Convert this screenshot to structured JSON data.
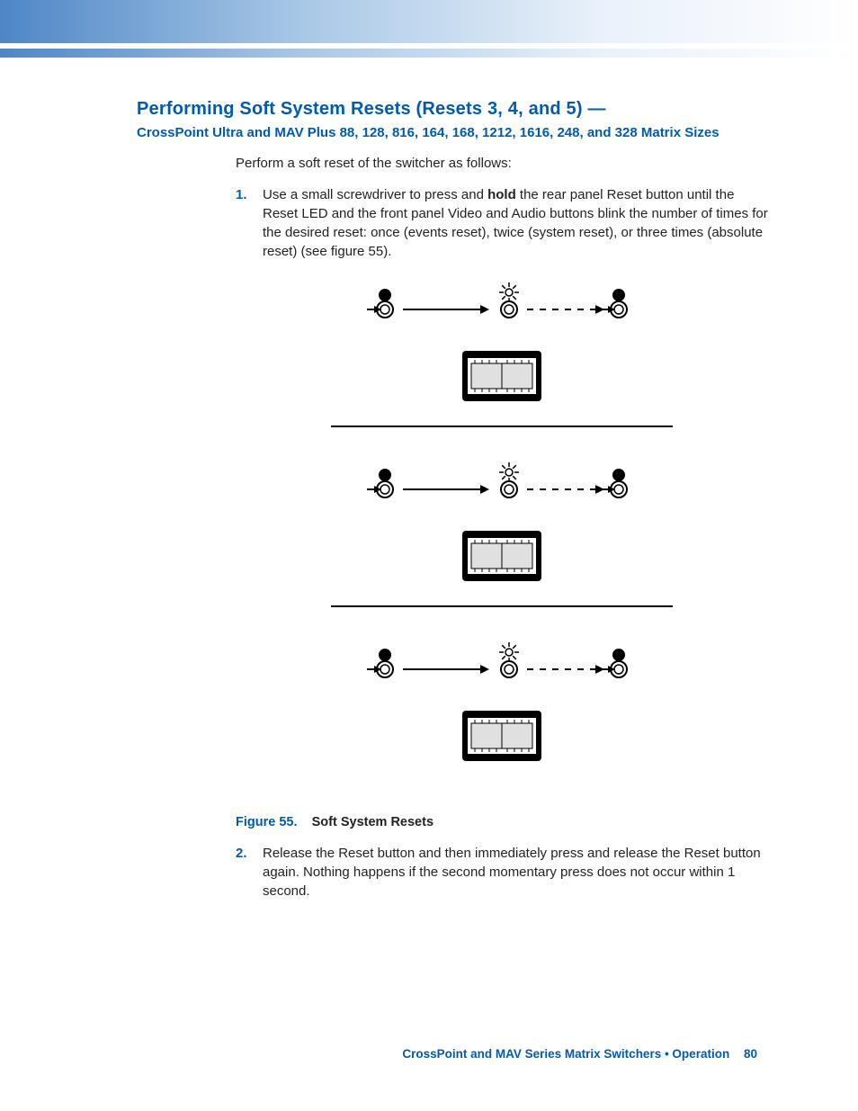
{
  "heading": {
    "title": "Performing Soft System Resets (Resets 3, 4, and 5) —",
    "subtitle": "CrossPoint Ultra and MAV Plus 88, 128, 816, 164, 168, 1212, 1616, 248, and 328 Matrix Sizes"
  },
  "intro": "Perform a soft reset of the switcher as follows:",
  "steps": [
    {
      "marker": "1.",
      "text_before": "Use a small screwdriver to press and ",
      "bold": "hold",
      "text_after": " the rear panel Reset button until the Reset LED and the front panel Video and Audio buttons blink the number of times for the desired reset: once (events reset), twice (system reset), or three times (absolute reset) (see figure 55)."
    },
    {
      "marker": "2.",
      "text_before": "Release the Reset button and then immediately press and release the Reset button again. Nothing happens if the second momentary press does not occur within 1 second.",
      "bold": "",
      "text_after": ""
    }
  ],
  "figure": {
    "label": "Figure 55.",
    "title": "Soft System Resets"
  },
  "footer": {
    "text": "CrossPoint and MAV Series Matrix Switchers • Operation",
    "page": "80"
  }
}
